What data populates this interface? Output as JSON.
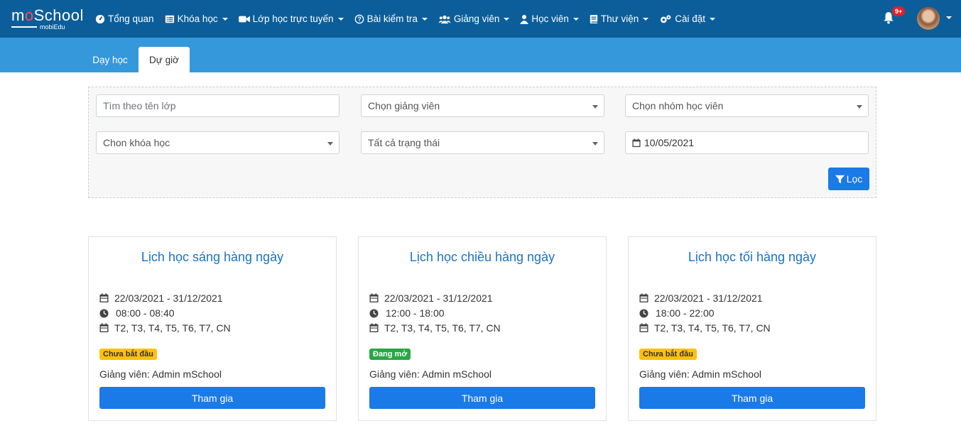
{
  "brand": {
    "logo_main_pre": "m",
    "logo_main_o": "o",
    "logo_main_post": "School",
    "logo_sub": "mobiEdu"
  },
  "nav": {
    "items": [
      {
        "label": "Tổng quan",
        "icon": "dashboard-icon",
        "dropdown": false
      },
      {
        "label": "Khóa học",
        "icon": "list-icon",
        "dropdown": true
      },
      {
        "label": "Lớp học trực tuyến",
        "icon": "video-icon",
        "dropdown": true
      },
      {
        "label": "Bài kiểm tra",
        "icon": "question-icon",
        "dropdown": true
      },
      {
        "label": "Giảng viên",
        "icon": "users-icon",
        "dropdown": true
      },
      {
        "label": "Học viên",
        "icon": "user-icon",
        "dropdown": true
      },
      {
        "label": "Thư viện",
        "icon": "book-icon",
        "dropdown": true
      },
      {
        "label": "Cài đặt",
        "icon": "gears-icon",
        "dropdown": true
      }
    ],
    "notifications_badge": "9+"
  },
  "tabs": {
    "teach": "Dạy học",
    "observe": "Dự giờ",
    "active": "observe"
  },
  "filters": {
    "class_search_placeholder": "Tìm theo tên lớp",
    "teacher_select": "Chọn giảng viên",
    "student_group_select": "Chọn nhóm học viên",
    "course_select": "Chon khóa học",
    "status_select": "Tất cả trạng thái",
    "date": "10/05/2021",
    "filter_button": "Lọc"
  },
  "cards": [
    {
      "title": "Lịch học sáng hàng ngày",
      "date_range": "22/03/2021 - 31/12/2021",
      "time": "08:00 - 08:40",
      "days": "T2, T3, T4, T5, T6, T7, CN",
      "status": "Chưa bắt đầu",
      "status_type": "pending",
      "teacher": "Giảng viên: Admin mSchool",
      "join": "Tham gia"
    },
    {
      "title": "Lịch học chiều hàng ngày",
      "date_range": "22/03/2021 - 31/12/2021",
      "time": "12:00 - 18:00",
      "days": "T2, T3, T4, T5, T6, T7, CN",
      "status": "Đang mở",
      "status_type": "open",
      "teacher": "Giảng viên: Admin mSchool",
      "join": "Tham gia"
    },
    {
      "title": "Lịch học tối hàng ngày",
      "date_range": "22/03/2021 - 31/12/2021",
      "time": "18:00 - 22:00",
      "days": "T2, T3, T4, T5, T6, T7, CN",
      "status": "Chưa bắt đầu",
      "status_type": "pending",
      "teacher": "Giảng viên: Admin mSchool",
      "join": "Tham gia"
    }
  ],
  "colors": {
    "navbar": "#0b5e9a",
    "tabbar": "#3498db",
    "primary": "#1a7ae8",
    "title": "#1a73c8",
    "pending": "#ffc107",
    "open": "#28a745"
  }
}
